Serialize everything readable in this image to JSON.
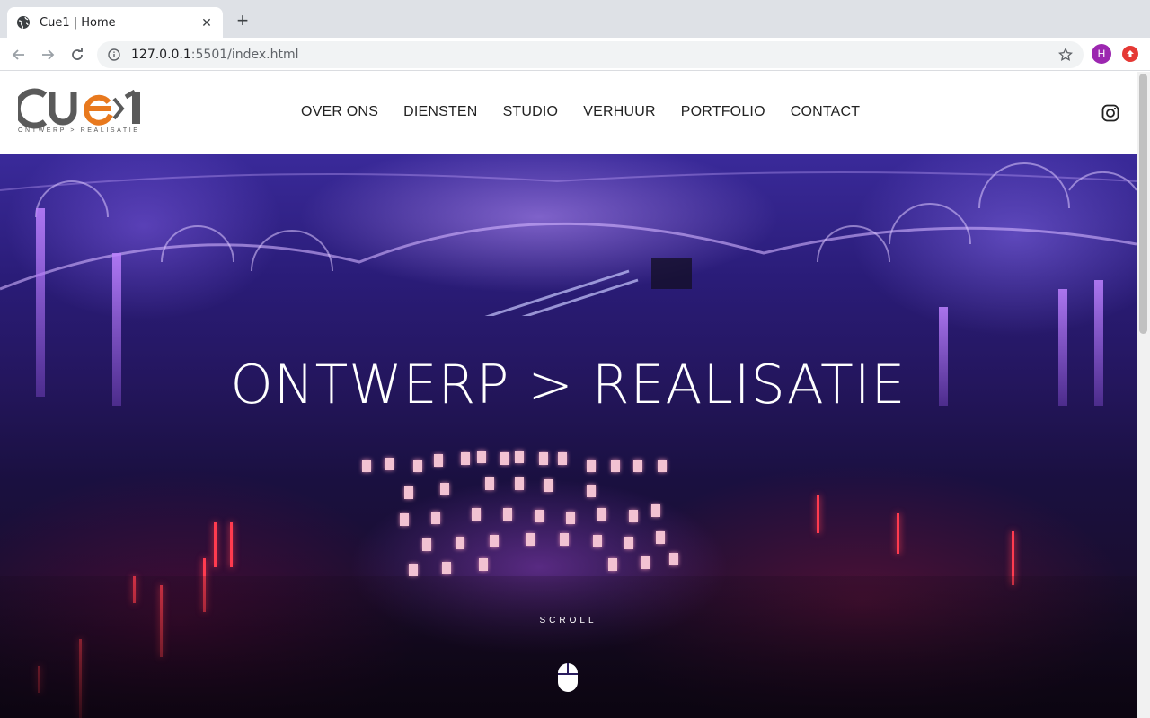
{
  "browser": {
    "tab_title": "Cue1 | Home",
    "url_host": "127.0.0.1",
    "url_rest": ":5501/index.html",
    "profile_initial": "H"
  },
  "site": {
    "logo_text": "CUE1",
    "logo_tagline": "ONTWERP > REALISATIE",
    "nav": [
      "OVER ONS",
      "DIENSTEN",
      "STUDIO",
      "VERHUUR",
      "PORTFOLIO",
      "CONTACT"
    ],
    "hero_title": "ONTWERP > REALISATIE",
    "scroll_label": "SCROLL"
  },
  "colors": {
    "logo_grey": "#5a5a5a",
    "logo_orange": "#e8791e",
    "avatar": "#9c27b0",
    "extension": "#e53935"
  },
  "icons": [
    "globe-icon",
    "close-icon",
    "plus-icon",
    "back-icon",
    "forward-icon",
    "reload-icon",
    "info-icon",
    "star-icon",
    "instagram-icon",
    "mouse-icon"
  ]
}
